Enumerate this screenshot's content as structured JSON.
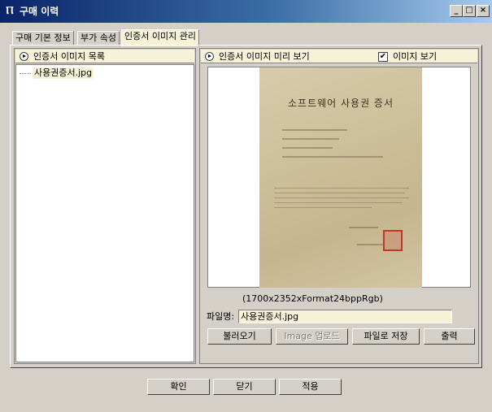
{
  "window": {
    "title": "구매 이력",
    "app_icon": "app-icon",
    "controls": {
      "minimize": "_",
      "maximize": "□",
      "close": "×"
    }
  },
  "tabs": [
    {
      "label": "구매 기본 정보",
      "active": false
    },
    {
      "label": "부가 속성",
      "active": false
    },
    {
      "label": "인증서 이미지 관리",
      "active": true
    }
  ],
  "left_panel": {
    "header": "인증서 이미지 목록",
    "files": [
      "사용권증서.jpg"
    ]
  },
  "right_panel": {
    "header": "인증서 이미지 미리 보기",
    "show_image": {
      "label": "이미지 보기",
      "checked": true,
      "mark": "✔"
    },
    "preview": {
      "document_title": "소프트웨어 사용권 증서"
    },
    "image_info": "(1700x2352xFormat24bppRgb)",
    "filename_label": "파일명:",
    "filename_value": "사용권증서.jpg",
    "buttons": {
      "load": "불러오기",
      "upload": "Image 업로드",
      "save": "파일로 저장",
      "print": "출력"
    }
  },
  "footer": {
    "ok": "확인",
    "close": "닫기",
    "apply": "적용"
  },
  "colors": {
    "face": "#d4d0c8",
    "highlight": "#f6f2d8",
    "title_start": "#0a246a",
    "title_end": "#a6caf0"
  }
}
